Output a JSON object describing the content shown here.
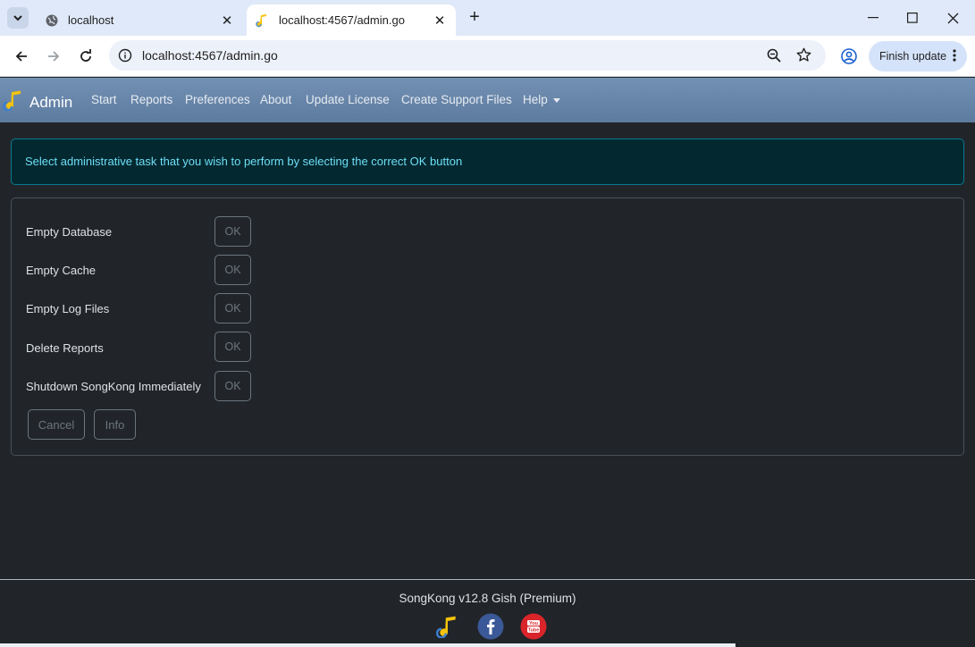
{
  "browser": {
    "tabs": [
      {
        "title": "localhost",
        "icon": "globe-icon"
      },
      {
        "title": "localhost:4567/admin.go",
        "icon": "songkong-note-icon",
        "active": true
      }
    ],
    "url": "localhost:4567/admin.go",
    "finish_update_label": "Finish update"
  },
  "navbar": {
    "brand": "Admin",
    "items": [
      "Start",
      "Reports",
      "Preferences",
      "About",
      "Update License",
      "Create Support Files",
      "Help"
    ]
  },
  "alert": {
    "text": "Select administrative task that you wish to perform by selecting the correct OK button"
  },
  "tasks": [
    {
      "label": "Empty Database",
      "button": "OK"
    },
    {
      "label": "Empty Cache",
      "button": "OK"
    },
    {
      "label": "Empty Log Files",
      "button": "OK"
    },
    {
      "label": "Delete Reports",
      "button": "OK"
    },
    {
      "label": "Shutdown SongKong Immediately",
      "button": "OK"
    }
  ],
  "actions": {
    "cancel_label": "Cancel",
    "info_label": "Info"
  },
  "footer": {
    "version_text": "SongKong v12.8 Gish (Premium)",
    "social_icons": [
      "songkong-note-icon",
      "facebook-icon",
      "youtube-icon"
    ]
  },
  "colors": {
    "background": "#212529",
    "navbar": "#6584a8",
    "alert_bg": "#032830",
    "alert_text": "#6edff6",
    "button_border": "#6c757d"
  }
}
